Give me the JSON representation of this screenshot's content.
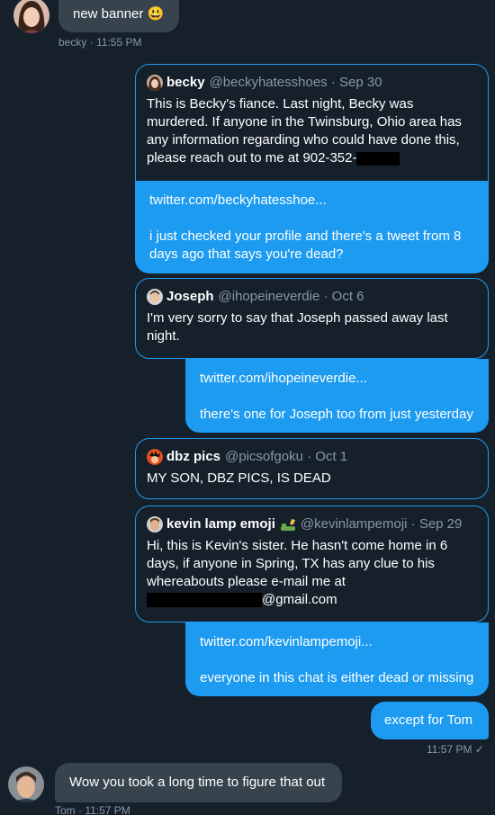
{
  "messages": {
    "m1": {
      "text": "new banner 😃",
      "meta": "becky · 11:55 PM"
    },
    "q1": {
      "name": "becky",
      "handle": "@beckyhatesshoes · Sep 30",
      "text": "This is Becky's fiance. Last night, Becky was murdered.  If anyone in the Twinsburg, Ohio area has any information regarding who could have done this, please reach out to me at 902-352-"
    },
    "b1": {
      "link": "twitter.com/beckyhatesshoe...",
      "text": "i just checked your profile and there's a tweet from 8 days ago that says you're dead?"
    },
    "q2": {
      "name": "Joseph",
      "handle": "@ihopeineverdie · Oct 6",
      "text": "I'm very sorry to say that Joseph passed away last night."
    },
    "b2": {
      "link": "twitter.com/ihopeineverdie...",
      "text": "there's one for Joseph too from just yesterday"
    },
    "q3": {
      "name": "dbz pics",
      "handle": "@picsofgoku · Oct 1",
      "text": "MY SON, DBZ PICS, IS DEAD"
    },
    "q4": {
      "name": "kevin lamp emoji",
      "handle": "@kevinlampemoji · Sep 29",
      "text": "Hi, this is Kevin's sister. He hasn't come home in 6 days, if anyone in Spring, TX has any clue to his whereabouts please e-mail me at",
      "email_suffix": "@gmail.com"
    },
    "b4": {
      "link": "twitter.com/kevinlampemoji...",
      "text": "everyone in this chat is either dead or missing"
    },
    "b5": {
      "text": "except for Tom",
      "meta": "11:57 PM ✓"
    },
    "m6": {
      "text": "Wow you took a long time to figure that out",
      "meta": "Tom · 11:57 PM"
    }
  },
  "colors": {
    "background": "#15202b",
    "accent": "#1d9bf0",
    "incoming": "#38444d",
    "muted": "#8899a6"
  }
}
